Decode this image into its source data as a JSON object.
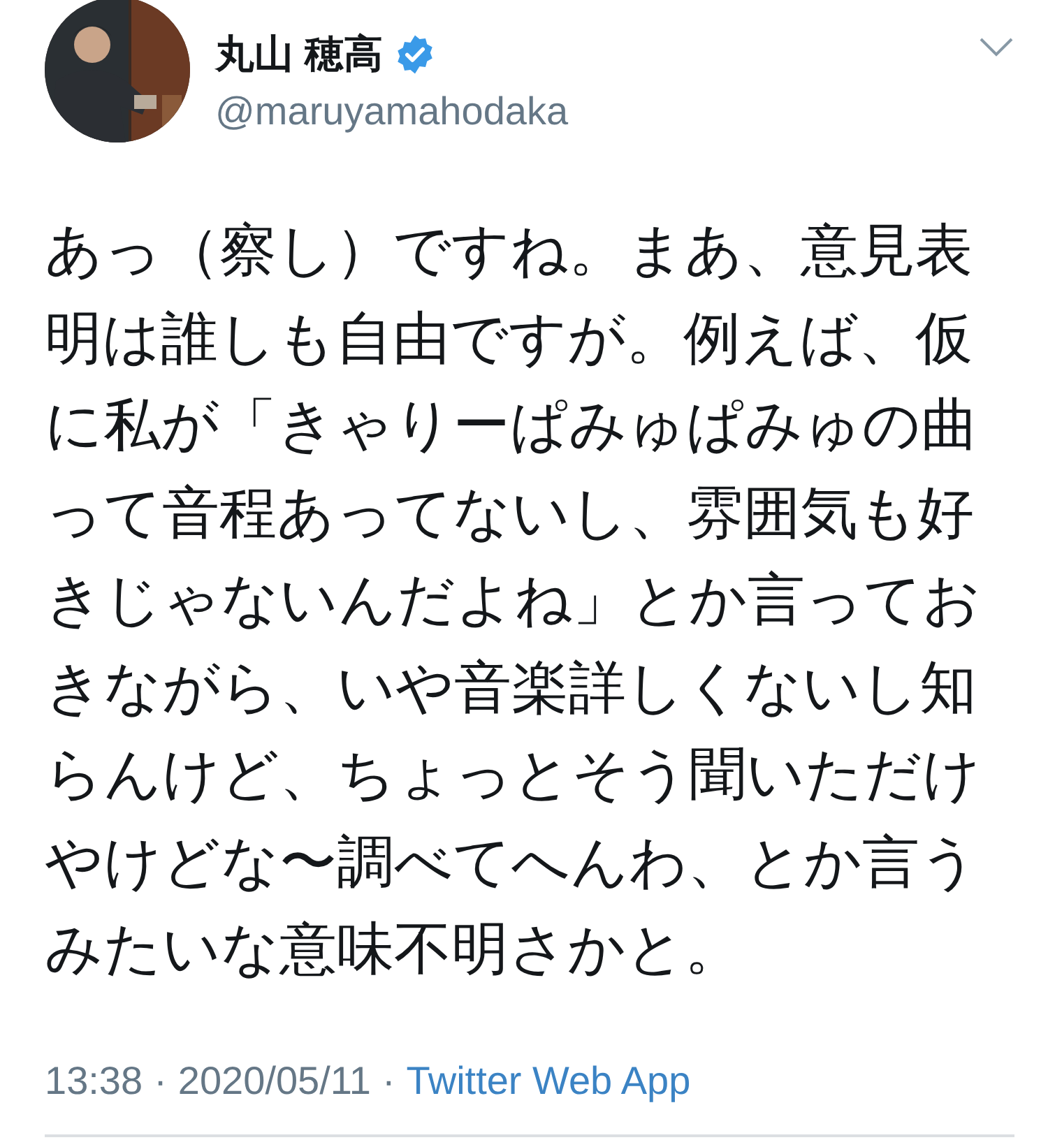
{
  "author": {
    "name": "丸山 穂高",
    "verified": true,
    "handle": "@maruyamahodaka"
  },
  "tweet": {
    "text": "あっ（察し）ですね。まあ、意見表明は誰しも自由ですが。例えば、仮に私が「きゃりーぱみゅぱみゅの曲って音程あってないし、雰囲気も好きじゃないんだよね」とか言っておきながら、いや音楽詳しくないし知らんけど、ちょっとそう聞いただけやけどな〜調べてへんわ、とか言うみたいな意味不明さかと。"
  },
  "meta": {
    "time": "13:38",
    "separator": "·",
    "date": "2020/05/11",
    "source": "Twitter Web App"
  }
}
